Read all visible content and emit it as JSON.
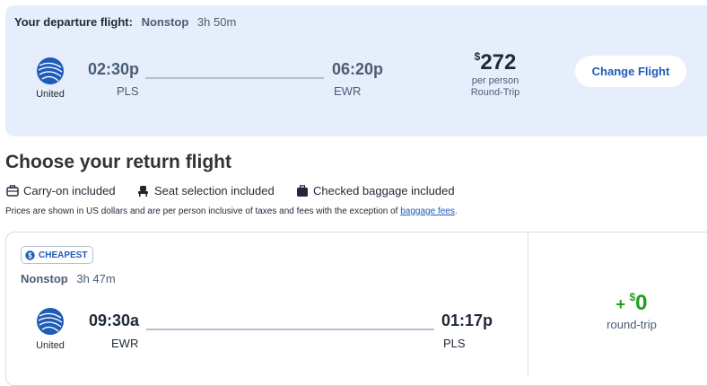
{
  "departure": {
    "label": "Your departure flight:",
    "stops": "Nonstop",
    "duration": "3h 50m",
    "airline": "United",
    "depart_time": "02:30p",
    "depart_code": "PLS",
    "arrive_time": "06:20p",
    "arrive_code": "EWR",
    "price_symbol": "$",
    "price": "272",
    "price_sub1": "per person",
    "price_sub2": "Round-Trip",
    "change_label": "Change Flight"
  },
  "return_section": {
    "title": "Choose your return flight",
    "features": [
      {
        "label": "Carry-on included",
        "icon": "briefcase-icon"
      },
      {
        "label": "Seat selection included",
        "icon": "seat-icon"
      },
      {
        "label": "Checked baggage included",
        "icon": "luggage-icon"
      }
    ],
    "note": "Prices are shown in US dollars and are per person inclusive of taxes and fees with the exception of",
    "note_link": "baggage fees",
    "note_end": "."
  },
  "return_flight": {
    "badge": "CHEAPEST",
    "stops": "Nonstop",
    "duration": "3h 47m",
    "airline": "United",
    "depart_time": "09:30a",
    "depart_code": "EWR",
    "arrive_time": "01:17p",
    "arrive_code": "PLS",
    "price_prefix": "+",
    "price_symbol": "$",
    "price": "0",
    "price_sub": "round-trip"
  },
  "colors": {
    "brand_blue": "#1f5bb8",
    "card_bg": "#e6eefb",
    "price_green": "#1ea01e"
  }
}
